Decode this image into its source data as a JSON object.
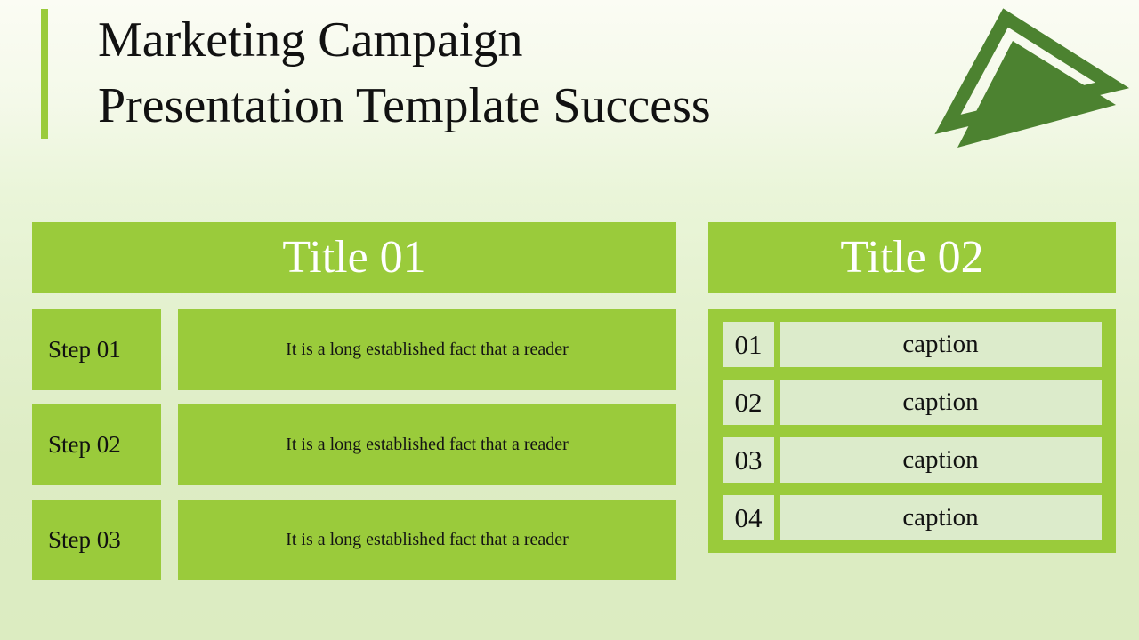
{
  "slide": {
    "title_lines": [
      "Marketing Campaign",
      "Presentation Template Success"
    ],
    "logo_name": "triangle-logo"
  },
  "colors": {
    "accent_green": "#9acb3b",
    "dark_green": "#4c8230",
    "mint": "#dcebcb",
    "background_top": "#fbfcf4",
    "background_bottom": "#dcecc1",
    "title_text": "#111111",
    "header_text": "#ffffff"
  },
  "left_panel": {
    "header": "Title 01",
    "steps": [
      {
        "label": "Step 01",
        "description": "It is a long established fact that a reader"
      },
      {
        "label": "Step 02",
        "description": "It is a long established fact that a reader"
      },
      {
        "label": "Step 03",
        "description": "It is a long established fact that a reader"
      }
    ]
  },
  "right_panel": {
    "header": "Title 02",
    "captions": [
      {
        "number": "01",
        "text": "caption"
      },
      {
        "number": "02",
        "text": "caption"
      },
      {
        "number": "03",
        "text": "caption"
      },
      {
        "number": "04",
        "text": "caption"
      }
    ]
  }
}
